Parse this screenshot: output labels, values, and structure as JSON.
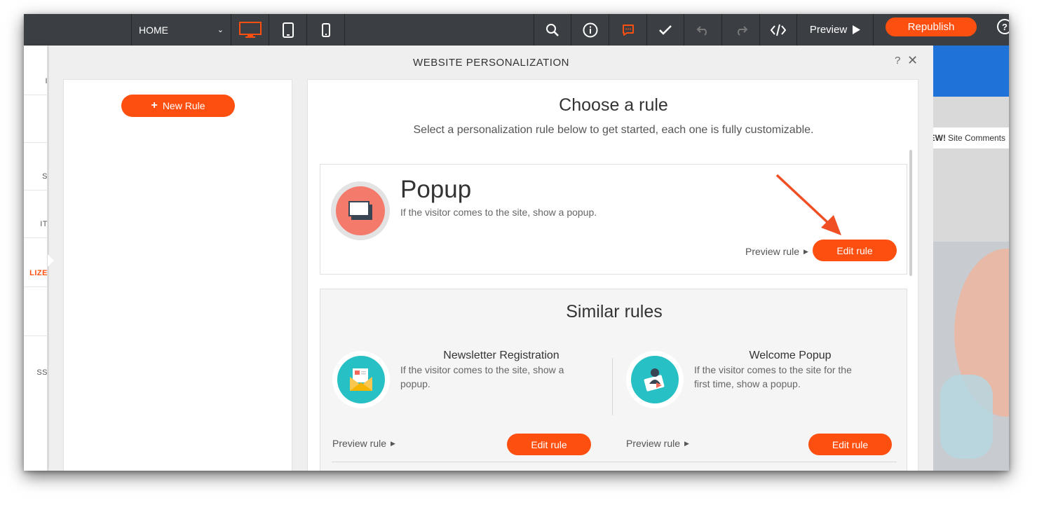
{
  "toolbar": {
    "page_select": "HOME",
    "preview_label": "Preview",
    "republish_label": "Republish",
    "help_label": "?",
    "icons": [
      "desktop-icon",
      "tablet-icon",
      "mobile-icon",
      "search-icon",
      "info-icon",
      "chat-icon",
      "check-icon",
      "undo-icon",
      "redo-icon",
      "code-icon",
      "play-icon"
    ],
    "accent": "#fd4f10"
  },
  "leftnav": {
    "items": [
      "I",
      "S",
      "IT",
      "LIZE",
      "SS"
    ],
    "active_index": 3
  },
  "modal": {
    "title": "WEBSITE PERSONALIZATION",
    "help": "?",
    "close": "✕",
    "new_rule_label": "New Rule",
    "choose_title": "Choose a rule",
    "choose_subtitle": "Select a personalization rule below to get started, each one is fully customizable.",
    "main_rule": {
      "title": "Popup",
      "description": "If the visitor comes to the site, show a popup.",
      "preview_label": "Preview rule",
      "edit_label": "Edit rule"
    },
    "similar_title": "Similar rules",
    "similar": [
      {
        "name": "Newsletter Registration",
        "description": "If the visitor comes to the site, show a popup.",
        "preview_label": "Preview rule",
        "edit_label": "Edit rule",
        "icon": "envelope-icon"
      },
      {
        "name": "Welcome Popup",
        "description": "If the visitor comes to the site for the first time, show a popup.",
        "preview_label": "Preview rule",
        "edit_label": "Edit rule",
        "icon": "welcome-video-icon"
      }
    ]
  },
  "background_site": {
    "comments_badge": "EW!",
    "comments_text": "Site Comments"
  }
}
